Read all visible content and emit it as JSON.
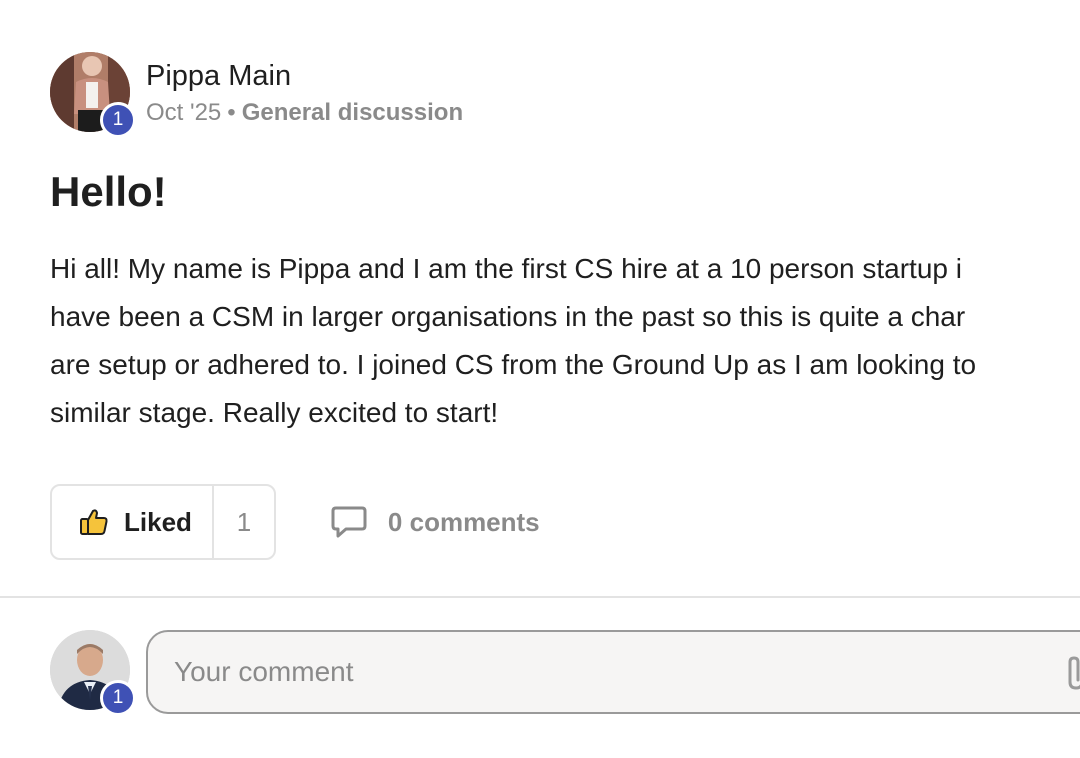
{
  "post": {
    "author": {
      "name": "Pippa Main",
      "level": "1",
      "avatar_icon": "user-avatar-photo"
    },
    "date": "Oct '25",
    "separator": "•",
    "category": "General discussion",
    "title": "Hello!",
    "body_lines": [
      "Hi all! My name is Pippa and I am the first CS hire at a 10 person startup i",
      "have been a CSM in larger organisations in the past so this is quite a char",
      "are setup or adhered to. I joined CS from the Ground Up as I am looking to",
      "similar stage. Really excited to start!"
    ]
  },
  "actions": {
    "like_label": "Liked",
    "like_count": "1",
    "like_icon": "thumbs-up-icon",
    "comments_label": "0 comments",
    "comments_icon": "speech-bubble-icon"
  },
  "composer": {
    "user_level": "1",
    "placeholder": "Your comment",
    "attach_icon": "paperclip-icon"
  },
  "colors": {
    "level_badge": "#3f51b5",
    "muted_text": "#8a8a8a",
    "border": "#e3e3e3"
  }
}
